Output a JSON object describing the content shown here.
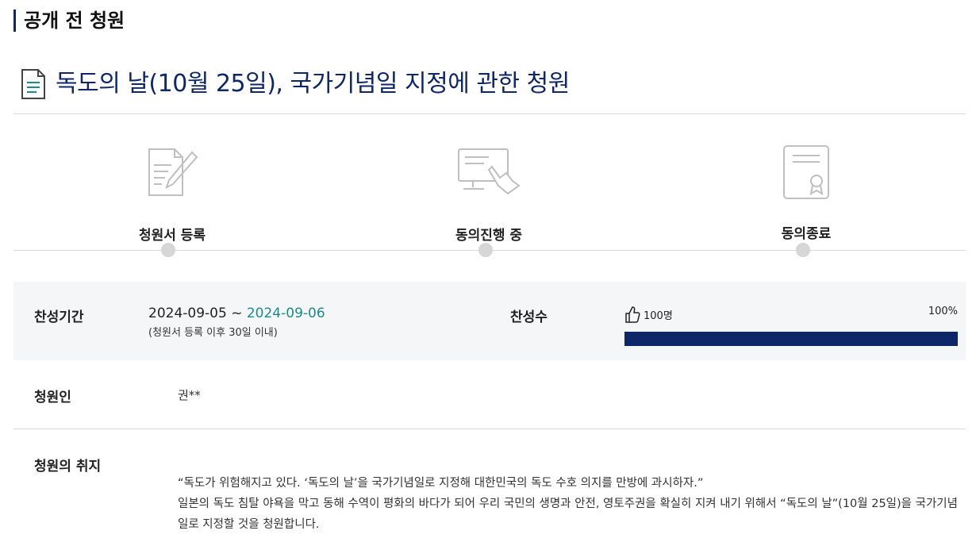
{
  "page": {
    "section_title": "공개 전 청원",
    "petition_title": "독도의 날(10월 25일), 국가기념일 지정에 관한 청원"
  },
  "steps": [
    {
      "label": "청원서 등록",
      "icon": "document-pen-icon"
    },
    {
      "label": "동의진행 중",
      "icon": "monitor-hand-icon"
    },
    {
      "label": "동의종료",
      "icon": "certificate-icon"
    }
  ],
  "support": {
    "period_label": "찬성기간",
    "start_date": "2024-09-05",
    "separator": "~",
    "end_date": "2024-09-06",
    "period_note": "(청원서 등록 이후 30일 이내)",
    "count_label": "찬성수",
    "count_text": "100명",
    "percent_text": "100%",
    "progress_fraction": 1.0
  },
  "petitioner": {
    "label": "청원인",
    "value": "권**"
  },
  "purpose": {
    "label": "청원의 취지",
    "quote": "“독도가 위험해지고 있다. ‘독도의 날’을 국가기념일로 지정해 대한민국의 독도 수호 의지를 만방에 과시하자.”",
    "body": "일본의 독도 침탈 야욕을 막고 동해 수역이 평화의 바다가 되어 우리 국민의 생명과 안전, 영토주권을 확실히 지켜 내기 위해서 “독도의 날”(10월 25일)을 국가기념일로 지정할 것을 청원합니다."
  },
  "colors": {
    "navy": "#0e2768",
    "teal": "#1c8c86",
    "band": "#f5f6f8",
    "icon_gray": "#bfbfbf"
  }
}
